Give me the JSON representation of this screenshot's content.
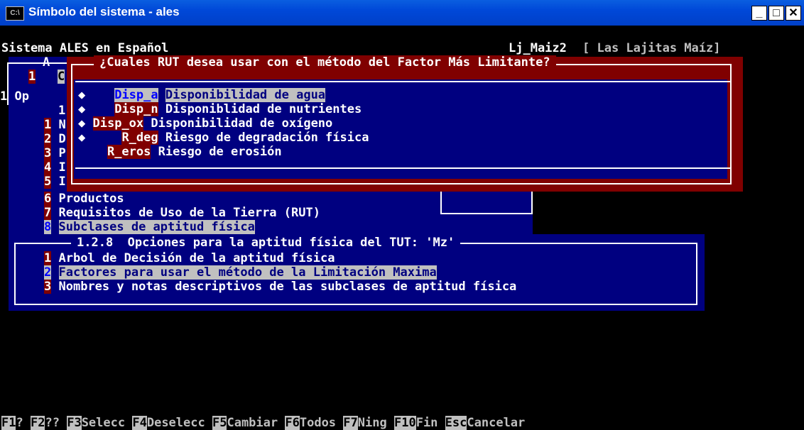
{
  "window": {
    "title": "Símbolo del sistema - ales",
    "icon": "console-icon",
    "buttons": [
      "minimize-icon",
      "maximize-icon",
      "close-icon"
    ],
    "icon_label": "C:\\"
  },
  "header": {
    "app": "Sistema ALES en Español",
    "model": "Lj_Maiz2",
    "location": "[ Las Lajitas Maíz]"
  },
  "bg_menu": {
    "frag_a": "A",
    "frag_1c": "1",
    "frag_c": "C",
    "frag_op": "1 Op",
    "frag_1": "1",
    "items": [
      {
        "n": "1",
        "t": "N"
      },
      {
        "n": "2",
        "t": "D"
      },
      {
        "n": "3",
        "t": "P"
      },
      {
        "n": "4",
        "t": "I"
      },
      {
        "n": "5",
        "t": "I"
      }
    ],
    "full_items": [
      {
        "n": "6",
        "t": "Productos"
      },
      {
        "n": "7",
        "t": "Requisitos de Uso de la Tierra (RUT)"
      },
      {
        "n": "8",
        "t": "Subclases de aptitud física"
      }
    ]
  },
  "submenu": {
    "title": "1.2.8  Opciones para la aptitud física del TUT: 'Mz'",
    "items": [
      {
        "n": "1",
        "t": "Arbol de Decisión de la aptitud física"
      },
      {
        "n": "2",
        "t": "Factores para usar el método de la Limitación Maxima"
      },
      {
        "n": "3",
        "t": "Nombres y notas descriptivos de las subclases de aptitud física"
      }
    ]
  },
  "dialog": {
    "title": "¿Cuales RUT desea usar con el método del Factor Más Limitante?",
    "rows": [
      {
        "mark": "◆",
        "code": "Disp_a",
        "desc": "Disponibilidad de agua"
      },
      {
        "mark": "◆",
        "code": "Disp_n",
        "desc": "Disponiblidad de nutrientes"
      },
      {
        "mark": "◆",
        "code": "Disp_ox",
        "desc": "Disponibilidad de oxígeno"
      },
      {
        "mark": "◆",
        "code": "R_deg",
        "desc": "Riesgo de degradación física"
      },
      {
        "mark": "",
        "code": "R_eros",
        "desc": "Riesgo de erosión"
      }
    ]
  },
  "fkeys": [
    {
      "k": "F1",
      "l": "?"
    },
    {
      "k": "F2",
      "l": "??"
    },
    {
      "k": "F3",
      "l": "Selecc"
    },
    {
      "k": "F4",
      "l": "Deselecc"
    },
    {
      "k": "F5",
      "l": "Cambiar"
    },
    {
      "k": "F6",
      "l": "Todos"
    },
    {
      "k": "F7",
      "l": "Ning"
    },
    {
      "k": "F10",
      "l": "Fin"
    },
    {
      "k": "Esc",
      "l": "Cancelar"
    }
  ]
}
